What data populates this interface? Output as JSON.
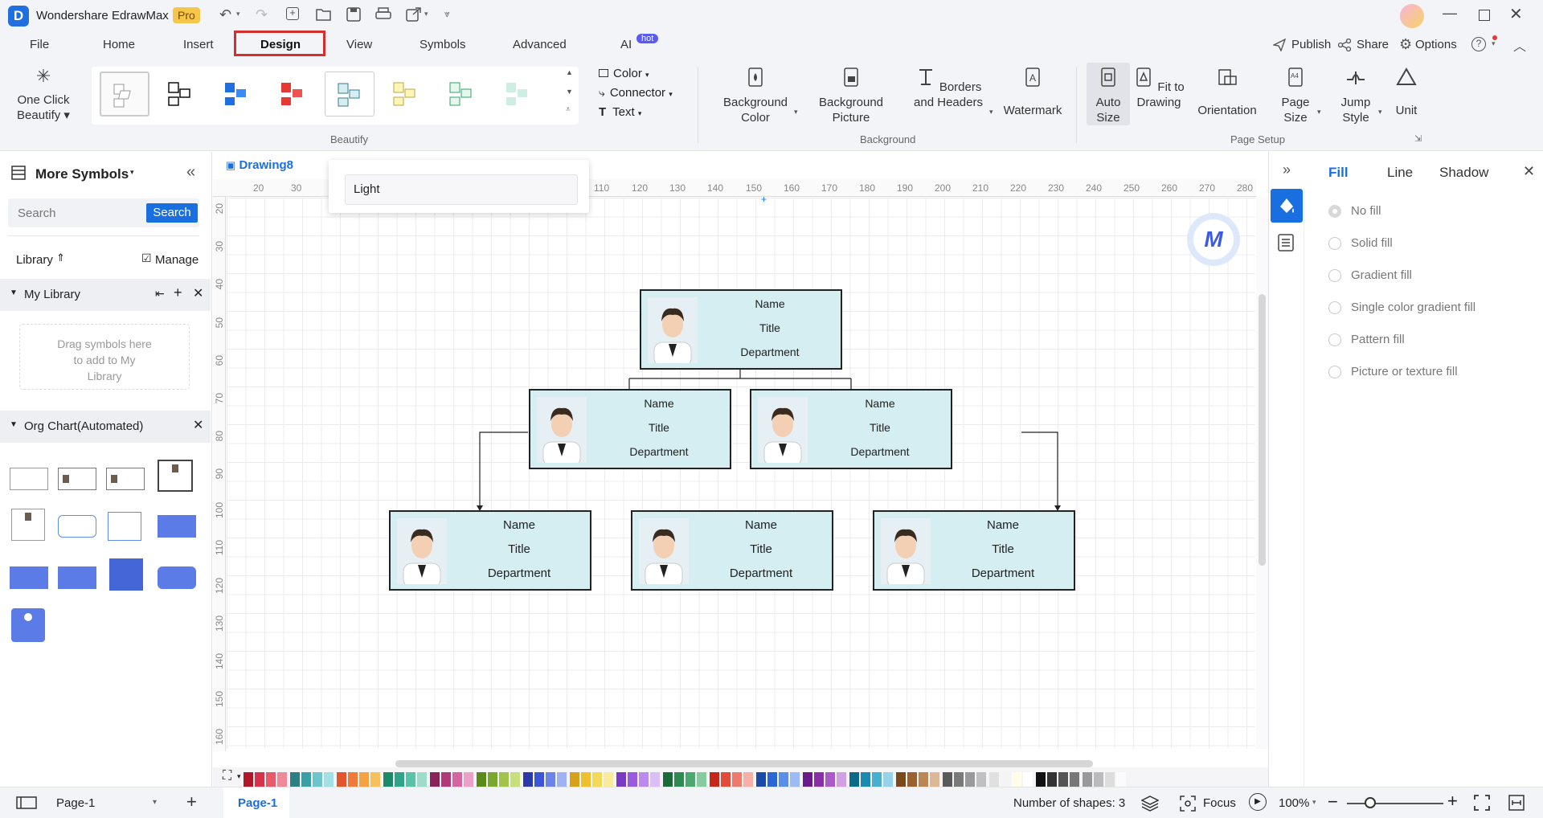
{
  "app": {
    "title": "Wondershare EdrawMax",
    "badge": "Pro"
  },
  "menu": {
    "items": [
      "File",
      "Home",
      "Insert",
      "Design",
      "View",
      "Symbols",
      "Advanced",
      "AI"
    ],
    "ai_badge": "hot",
    "active": "Design",
    "right": {
      "publish": "Publish",
      "share": "Share",
      "options": "Options"
    }
  },
  "ribbon": {
    "one_click": "One Click Beautify",
    "color": "Color",
    "connector": "Connector",
    "text": "Text",
    "beautify_label": "Beautify",
    "background_color": "Background Color",
    "background_picture": "Background Picture",
    "borders_headers": "Borders and Headers",
    "watermark": "Watermark",
    "background_label": "Background",
    "auto_size": "Auto Size",
    "fit_to_drawing": "Fit to Drawing",
    "orientation": "Orientation",
    "page_size": "Page Size",
    "jump_style": "Jump Style",
    "unit": "Unit",
    "page_setup_label": "Page Setup"
  },
  "tooltip": {
    "text": "Light"
  },
  "left": {
    "title": "More Symbols",
    "search_placeholder": "Search",
    "search_button": "Search",
    "library": "Library",
    "manage": "Manage",
    "my_library": "My Library",
    "drag_hint": "Drag symbols here to add to My Library",
    "org_chart": "Org Chart(Automated)"
  },
  "canvas": {
    "tab": "Drawing8",
    "ruler_h": [
      "20",
      "30",
      "110",
      "120",
      "130",
      "140",
      "150",
      "160",
      "170",
      "180",
      "190",
      "200",
      "210",
      "220",
      "230",
      "240",
      "250",
      "260",
      "270",
      "280"
    ],
    "ruler_v": [
      "20",
      "30",
      "40",
      "50",
      "60",
      "70",
      "80",
      "90",
      "100",
      "110",
      "120",
      "130",
      "140",
      "150",
      "160"
    ],
    "card": {
      "name": "Name",
      "title": "Title",
      "department": "Department"
    }
  },
  "right": {
    "tabs": [
      "Fill",
      "Line",
      "Shadow"
    ],
    "options": [
      "No fill",
      "Solid fill",
      "Gradient fill",
      "Single color gradient fill",
      "Pattern fill",
      "Picture or texture fill"
    ]
  },
  "status": {
    "page_select": "Page-1",
    "page_tab": "Page-1",
    "shapes": "Number of shapes: 3",
    "focus": "Focus",
    "zoom": "100%"
  },
  "colors": {
    "accent": "#1a6fe0",
    "highlight": "#d32f2f",
    "card_fill": "#d4eef2"
  }
}
